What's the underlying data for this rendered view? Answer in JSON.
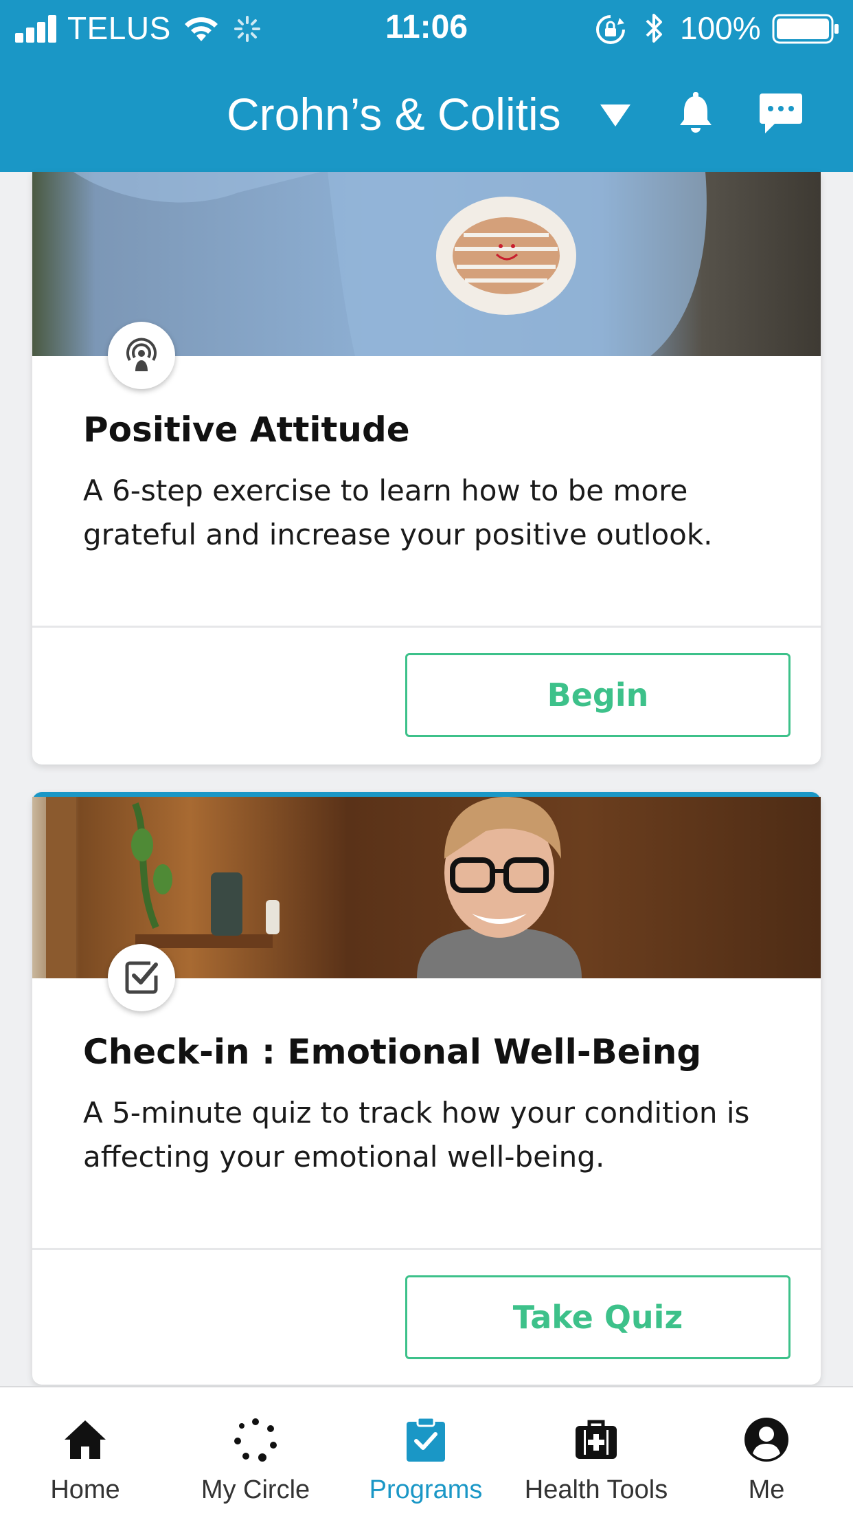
{
  "status_bar": {
    "carrier": "TELUS",
    "time": "11:06",
    "battery_percent": "100%"
  },
  "header": {
    "title": "Crohn’s & Colitis"
  },
  "cards": [
    {
      "title": "Positive Attitude",
      "description": "A 6-step exercise to learn how to be more grateful and increase your positive outlook.",
      "button_label": "Begin",
      "badge_icon": "podcast-icon",
      "image": "jeans-smiley-patch-photo"
    },
    {
      "title": "Check-in : Emotional Well-Being",
      "description": "A 5-minute quiz to track how your condition is affecting your emotional well-being.",
      "button_label": "Take Quiz",
      "badge_icon": "checkbox-icon",
      "image": "smiling-woman-glasses-photo"
    }
  ],
  "bottom_nav": {
    "items": [
      {
        "label": "Home",
        "icon": "home-icon",
        "active": false
      },
      {
        "label": "My Circle",
        "icon": "circle-dots-icon",
        "active": false
      },
      {
        "label": "Programs",
        "icon": "clipboard-check-icon",
        "active": true
      },
      {
        "label": "Health Tools",
        "icon": "medical-kit-icon",
        "active": false
      },
      {
        "label": "Me",
        "icon": "user-avatar-icon",
        "active": false
      }
    ]
  },
  "colors": {
    "brand_blue": "#1a97c6",
    "button_green": "#3dc18a",
    "background": "#eff0f2"
  }
}
